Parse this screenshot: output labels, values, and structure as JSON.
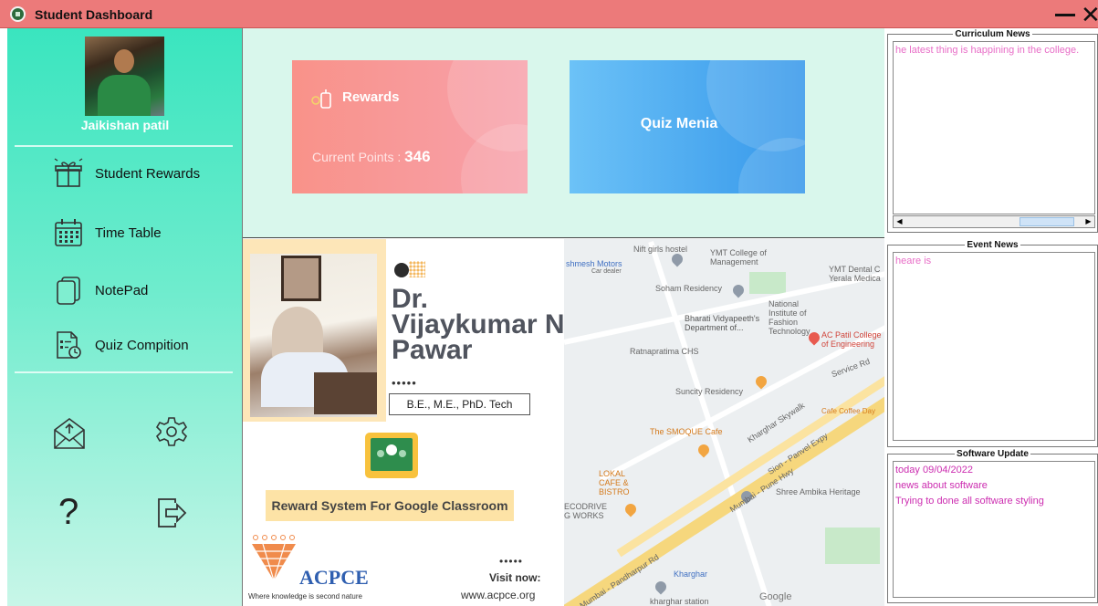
{
  "window": {
    "title": "Student Dashboard",
    "close_glyph": "✕"
  },
  "sidebar": {
    "username": "Jaikishan patil",
    "nav": [
      {
        "label": "Student Rewards",
        "icon": "gift-icon"
      },
      {
        "label": "Time Table",
        "icon": "calendar-icon"
      },
      {
        "label": "NotePad",
        "icon": "notepad-icon"
      },
      {
        "label": "Quiz Compition",
        "icon": "quiz-icon"
      }
    ],
    "help_glyph": "?"
  },
  "rewards_card": {
    "title": "Rewards",
    "points_label": "Current Points : ",
    "points_value": "346"
  },
  "quiz_card": {
    "title": "Quiz Menia"
  },
  "poster": {
    "name": "Dr. Vijaykumar N. Pawar",
    "dots": "•••••",
    "degree": "B.E., M.E., PhD. Tech",
    "banner": "Reward  System For Google  Classroom",
    "org": "ACPCE",
    "tagline": "Where knowledge is second nature",
    "visit_label": "Visit now:",
    "url": "www.acpce.org"
  },
  "map": {
    "labels": [
      "Nift girls hostel",
      "YMT College of Management",
      "YMT Dental C Yerala Medica",
      "shmesh Motors",
      "Car dealer",
      "Soham Residency",
      "National Institute of Fashion Technology",
      "Bharati Vidyapeeth's Department of...",
      "AC Patil College of Engineering",
      "Ratnapratima CHS",
      "Suncity Residency",
      "The SMOQUE Cafe",
      "Cafe Coffee Day",
      "LOKAL CAFE & BISTRO",
      "Shree Ambika Heritage",
      "Sion - Panvel Expy",
      "Mumbai - Pune Hwy",
      "Mumbai - Pandharpur Rd",
      "Kharghar",
      "kharghar station",
      "ECODRIVE G WORKS",
      "Service Rd",
      "Kharghar Skywalk",
      "Google"
    ]
  },
  "curriculum_news": {
    "title": "Curriculum News",
    "text": "he latest thing is happining in the college."
  },
  "event_news": {
    "title": "Event News",
    "text": "heare is"
  },
  "software_update": {
    "title": "Software Update",
    "lines": [
      "today 09/04/2022",
      "news about software",
      "Trying to done all software styling"
    ]
  },
  "colors": {
    "title_bar": "#ec7a7a",
    "sidebar_top": "#3ae5bf",
    "content_bg": "#d9f7ec",
    "rewards_card": "#f99289",
    "quiz_card": "#3597ea",
    "news_text": "#e86dc7"
  }
}
